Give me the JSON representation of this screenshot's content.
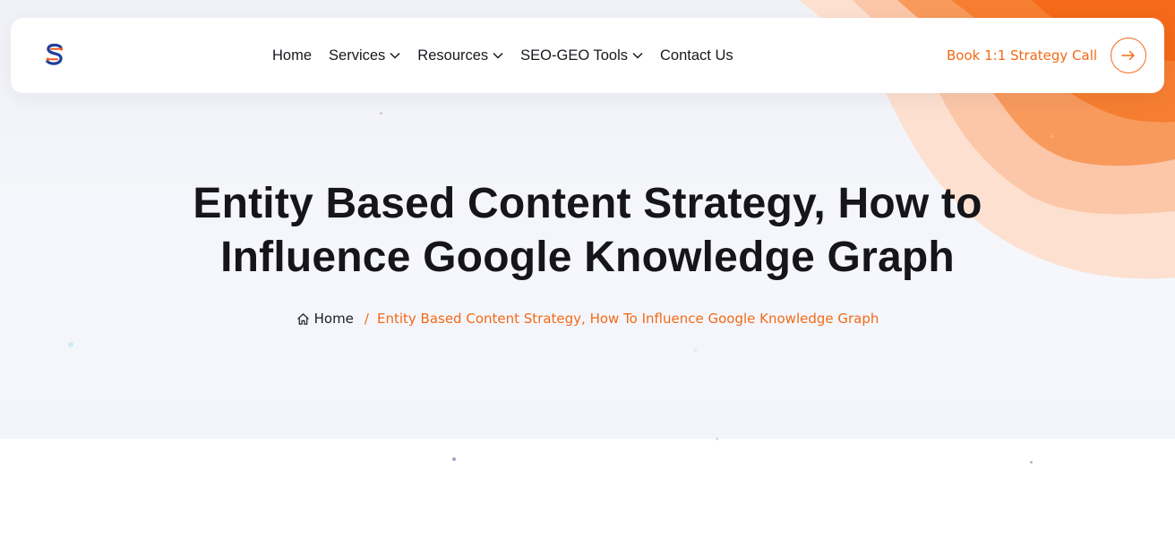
{
  "brand": {
    "accent": "#f26a16",
    "text": "#15151a"
  },
  "nav": {
    "items": [
      {
        "label": "Home",
        "has_dropdown": false
      },
      {
        "label": "Services",
        "has_dropdown": true
      },
      {
        "label": "Resources",
        "has_dropdown": true
      },
      {
        "label": "SEO-GEO Tools",
        "has_dropdown": true
      },
      {
        "label": "Contact Us",
        "has_dropdown": false
      }
    ],
    "cta_label": "Book 1:1 Strategy Call"
  },
  "hero": {
    "title_line1": "Entity Based Content Strategy, How to",
    "title_line2": "Influence Google Knowledge Graph",
    "breadcrumb": {
      "home_label": "Home",
      "separator": "/",
      "current": "Entity Based Content Strategy, How To Influence Google Knowledge Graph"
    }
  },
  "icons": {
    "logo": "s-monogram-logo-icon",
    "dropdown": "chevron-down-icon",
    "cta": "arrow-right-icon",
    "home": "home-icon"
  }
}
